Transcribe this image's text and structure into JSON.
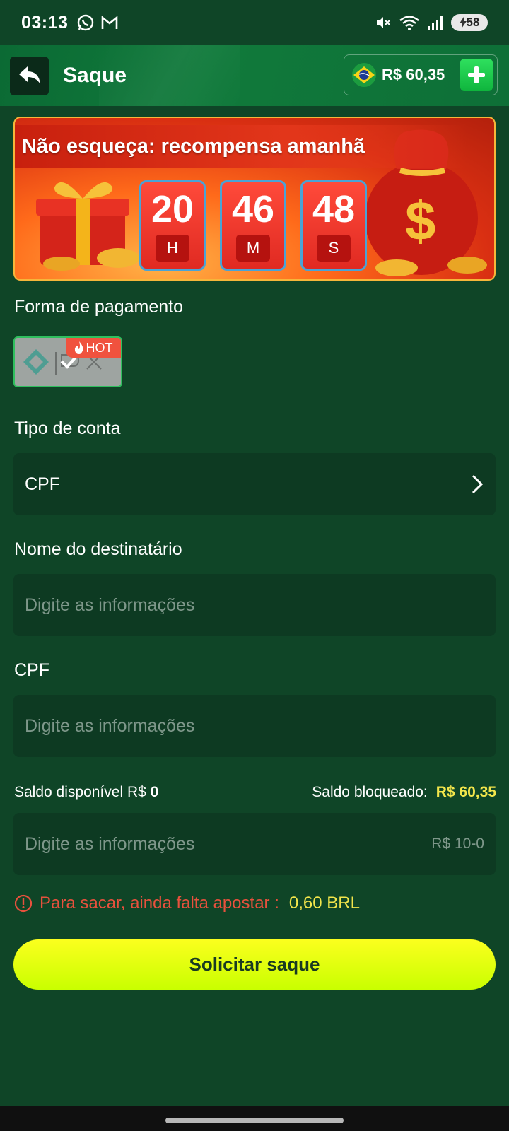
{
  "status_bar": {
    "time": "03:13",
    "battery": "58"
  },
  "header": {
    "title": "Saque",
    "balance": "R$ 60,35"
  },
  "banner": {
    "title": "Não esqueça: recompensa amanhã",
    "timer": [
      {
        "value": "20",
        "unit": "H"
      },
      {
        "value": "46",
        "unit": "M"
      },
      {
        "value": "48",
        "unit": "S"
      }
    ]
  },
  "payment": {
    "label": "Forma de pagamento",
    "method_badge": "HOT"
  },
  "account_type": {
    "label": "Tipo de conta",
    "value": "CPF"
  },
  "recipient_name": {
    "label": "Nome do destinatário",
    "placeholder": "Digite as informações"
  },
  "cpf": {
    "label": "CPF",
    "placeholder": "Digite as informações"
  },
  "saldo": {
    "available_label": "Saldo disponível R$",
    "available_value": "0",
    "blocked_label": "Saldo bloqueado:",
    "blocked_value": "R$ 60,35"
  },
  "amount": {
    "placeholder": "Digite as informações",
    "range_hint": "R$ 10-0"
  },
  "warning": {
    "text": "Para sacar, ainda falta apostar :",
    "amount": "0,60 BRL"
  },
  "submit": {
    "label": "Solicitar saque"
  },
  "colors": {
    "background": "#0f4527",
    "accent_yellow": "#f2e54b",
    "warning_red": "#e8513d",
    "button_gradient_top": "#fbff1e",
    "button_gradient_bottom": "#c9ff00"
  }
}
